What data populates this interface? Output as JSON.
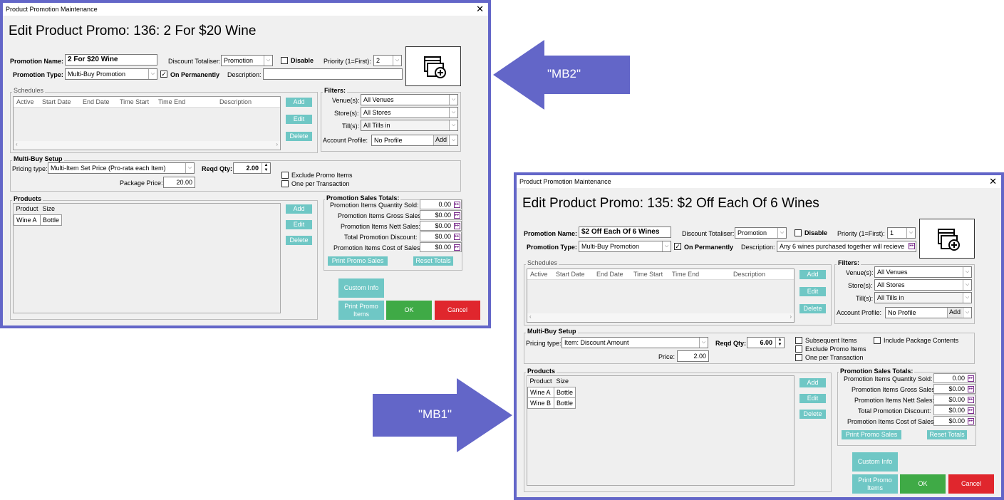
{
  "colors": {
    "frame": "#6366c8",
    "teal": "#6fc7c5",
    "ok": "#3faa46",
    "cancel": "#e0262d",
    "callout": "#6366c8"
  },
  "callouts": {
    "mb2": "\"MB2\"",
    "mb1": "\"MB1\""
  },
  "win1": {
    "title": "Product Promotion Maintenance",
    "close": "✕",
    "heading": "Edit Product Promo: 136: 2 For $20 Wine",
    "promo_name_label": "Promotion Name:",
    "promo_name": "2 For $20 Wine",
    "discount_totaliser_label": "Discount Totaliser:",
    "discount_totaliser": "Promotion",
    "disable_label": "Disable",
    "priority_label": "Priority (1=First):",
    "priority": "2",
    "promo_type_label": "Promotion Type:",
    "promo_type": "Multi-Buy Promotion",
    "on_permanently_label": "On Permanently",
    "description_label": "Description:",
    "description": "",
    "schedules_label": "Schedules",
    "schedule_cols": [
      "Active",
      "Start Date",
      "End Date",
      "Time Start",
      "Time End",
      "Description"
    ],
    "sched_add": "Add",
    "sched_edit": "Edit",
    "sched_delete": "Delete",
    "filters_label": "Filters:",
    "venues_label": "Venue(s):",
    "venues": "All Venues",
    "stores_label": "Store(s):",
    "stores": "All Stores",
    "tills_label": "Till(s):",
    "tills": "All Tills in",
    "account_profile_label": "Account Profile:",
    "account_profile": "No Profile",
    "account_add": "Add",
    "multibuy_label": "Multi-Buy Setup",
    "pricing_type_label": "Pricing type:",
    "pricing_type": "Multi-Item Set Price (Pro-rata each Item)",
    "reqd_qty_label": "Reqd Qty:",
    "reqd_qty": "2.00",
    "exclude_label": "Exclude Promo Items",
    "one_per_label": "One per Transaction",
    "package_price_label": "Package Price:",
    "package_price": "20.00",
    "products_label": "Products",
    "product_cols": [
      "Product",
      "Size"
    ],
    "products": [
      [
        "Wine A",
        "Bottle"
      ]
    ],
    "prod_add": "Add",
    "prod_edit": "Edit",
    "prod_delete": "Delete",
    "totals_label": "Promotion Sales Totals:",
    "totals": [
      {
        "label": "Promotion Items Quantity Sold:",
        "value": "0.00"
      },
      {
        "label": "Promotion Items Gross Sales:",
        "value": "$0.00"
      },
      {
        "label": "Promotion Items Nett Sales:",
        "value": "$0.00"
      },
      {
        "label": "Total Promotion Discount:",
        "value": "$0.00"
      },
      {
        "label": "Promotion Items Cost of Sales:",
        "value": "$0.00"
      }
    ],
    "print_promo_sales": "Print Promo Sales",
    "reset_totals": "Reset Totals",
    "custom_info": "Custom Info",
    "print_promo_items": "Print Promo Items",
    "ok": "OK",
    "cancel": "Cancel"
  },
  "win2": {
    "title": "Product Promotion Maintenance",
    "close": "✕",
    "heading": "Edit Product Promo: 135: $2 Off Each Of 6 Wines",
    "promo_name_label": "Promotion Name:",
    "promo_name": "$2 Off Each Of 6 Wines",
    "discount_totaliser_label": "Discount Totaliser:",
    "discount_totaliser": "Promotion",
    "disable_label": "Disable",
    "priority_label": "Priority (1=First):",
    "priority": "1",
    "promo_type_label": "Promotion Type:",
    "promo_type": "Multi-Buy Promotion",
    "on_permanently_label": "On Permanently",
    "description_label": "Description:",
    "description": "Any 6 wines purchased together will recieve",
    "schedules_label": "Schedules",
    "schedule_cols": [
      "Active",
      "Start Date",
      "End Date",
      "Time Start",
      "Time End",
      "Description"
    ],
    "sched_add": "Add",
    "sched_edit": "Edit",
    "sched_delete": "Delete",
    "filters_label": "Filters:",
    "venues_label": "Venue(s):",
    "venues": "All Venues",
    "stores_label": "Store(s):",
    "stores": "All Stores",
    "tills_label": "Till(s):",
    "tills": "All Tills in",
    "account_profile_label": "Account Profile:",
    "account_profile": "No Profile",
    "account_add": "Add",
    "multibuy_label": "Multi-Buy Setup",
    "pricing_type_label": "Pricing type:",
    "pricing_type": "Item: Discount Amount",
    "reqd_qty_label": "Reqd Qty:",
    "reqd_qty": "6.00",
    "subsequent_label": "Subsequent Items",
    "include_package_label": "Include Package Contents",
    "exclude_label": "Exclude Promo Items",
    "one_per_label": "One per Transaction",
    "price_label": "Price:",
    "price": "2.00",
    "products_label": "Products",
    "product_cols": [
      "Product",
      "Size"
    ],
    "products": [
      [
        "Wine A",
        "Bottle"
      ],
      [
        "Wine B",
        "Bottle"
      ]
    ],
    "prod_add": "Add",
    "prod_edit": "Edit",
    "prod_delete": "Delete",
    "totals_label": "Promotion Sales Totals:",
    "totals": [
      {
        "label": "Promotion Items Quantity Sold:",
        "value": "0.00"
      },
      {
        "label": "Promotion Items Gross Sales:",
        "value": "$0.00"
      },
      {
        "label": "Promotion Items Nett Sales:",
        "value": "$0.00"
      },
      {
        "label": "Total Promotion Discount:",
        "value": "$0.00"
      },
      {
        "label": "Promotion Items Cost of Sales:",
        "value": "$0.00"
      }
    ],
    "print_promo_sales": "Print Promo Sales",
    "reset_totals": "Reset Totals",
    "custom_info": "Custom Info",
    "print_promo_items": "Print Promo Items",
    "ok": "OK",
    "cancel": "Cancel"
  }
}
